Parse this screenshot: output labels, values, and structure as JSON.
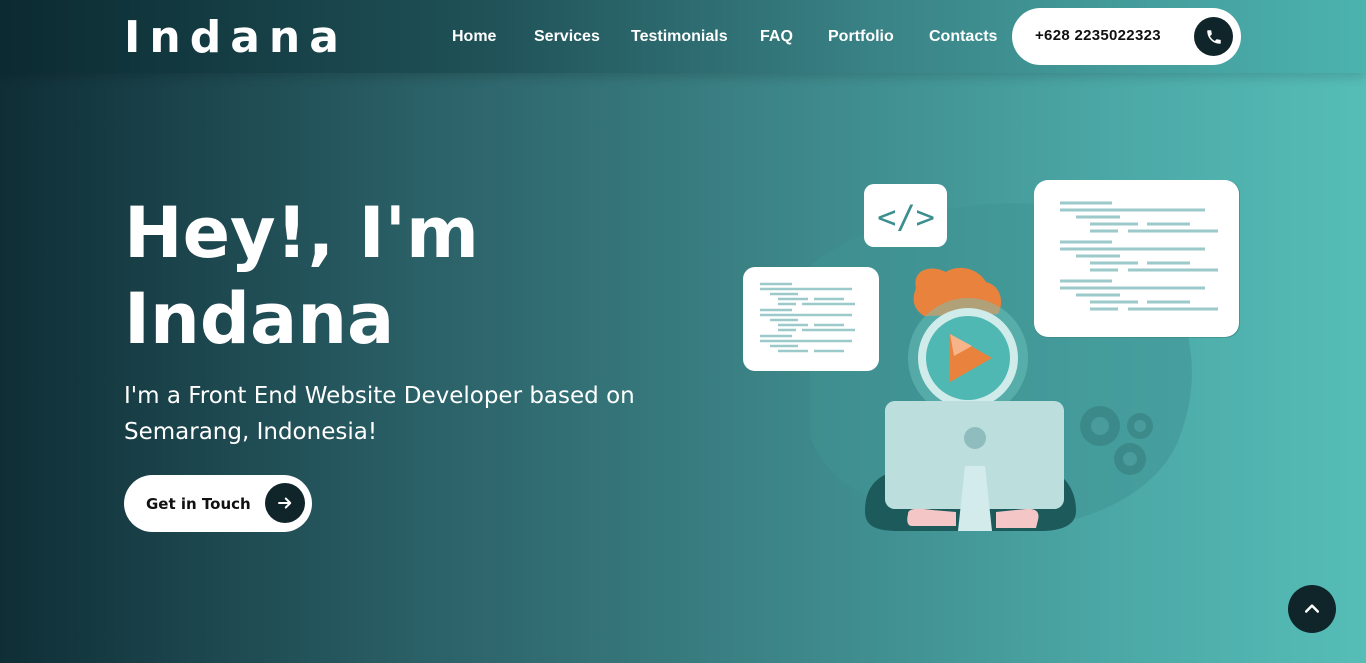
{
  "header": {
    "logo": "Indana",
    "nav": [
      "Home",
      "Services",
      "Testimonials",
      "FAQ",
      "Portfolio",
      "Contacts"
    ],
    "phone": "+628 2235022323",
    "phone_icon": "phone-icon"
  },
  "hero": {
    "title_line1": "Hey!, I'm",
    "title_line2": "Indana",
    "subtitle": "I'm a Front End Website Developer based on Semarang, Indonesia!",
    "cta_label": "Get in Touch",
    "cta_icon": "arrow-right-icon",
    "code_tag": "</>",
    "illustration": "developer-illustration"
  },
  "scroll_top_icon": "chevron-up-icon",
  "colors": {
    "dark": "#0f2529",
    "teal": "#4fb8b3",
    "orange": "#e8823d"
  }
}
